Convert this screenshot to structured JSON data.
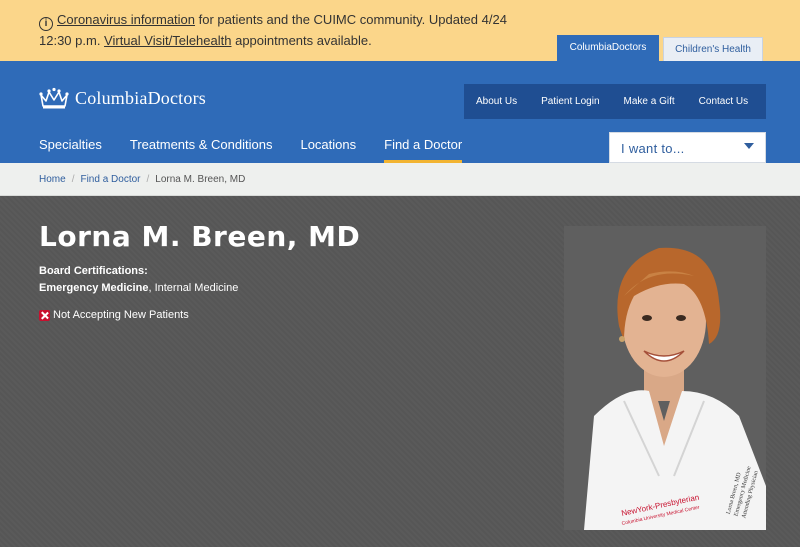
{
  "alert": {
    "link1": "Coronavirus information",
    "text1": " for patients and the CUIMC community. Updated 4/24 12:30 p.m. ",
    "link2": "Virtual Visit/Telehealth",
    "text2": " appointments available."
  },
  "site_tabs": {
    "active": "ColumbiaDoctors",
    "inactive": "Children's Health"
  },
  "header": {
    "logo_text": "ColumbiaDoctors",
    "utility": [
      "About Us",
      "Patient Login",
      "Make a Gift",
      "Contact Us"
    ],
    "nav": [
      "Specialties",
      "Treatments & Conditions",
      "Locations",
      "Find a Doctor"
    ],
    "i_want_to": "I want to..."
  },
  "breadcrumb": {
    "items": [
      "Home",
      "Find a Doctor",
      "Lorna M. Breen, MD"
    ]
  },
  "profile": {
    "name": "Lorna M. Breen, MD",
    "certifications_label": "Board Certifications:",
    "cert_primary": "Emergency Medicine",
    "cert_secondary": "Internal Medicine",
    "accepting_status": "Not Accepting New Patients",
    "photo_coat_text": "NewYork-Presbyterian",
    "photo_coat_subtext": "Columbia University Medical Center",
    "photo_badge_name": "Lorna Breen, MD",
    "photo_badge_line2": "Emergency Medicine",
    "photo_badge_line3": "Attending Physician"
  },
  "colors": {
    "alert_bg": "#fbd68a",
    "brand_blue": "#2f6bb8",
    "utility_blue": "#1f4e92",
    "nav_active_underline": "#f2b431",
    "status_red": "#c8102e"
  }
}
